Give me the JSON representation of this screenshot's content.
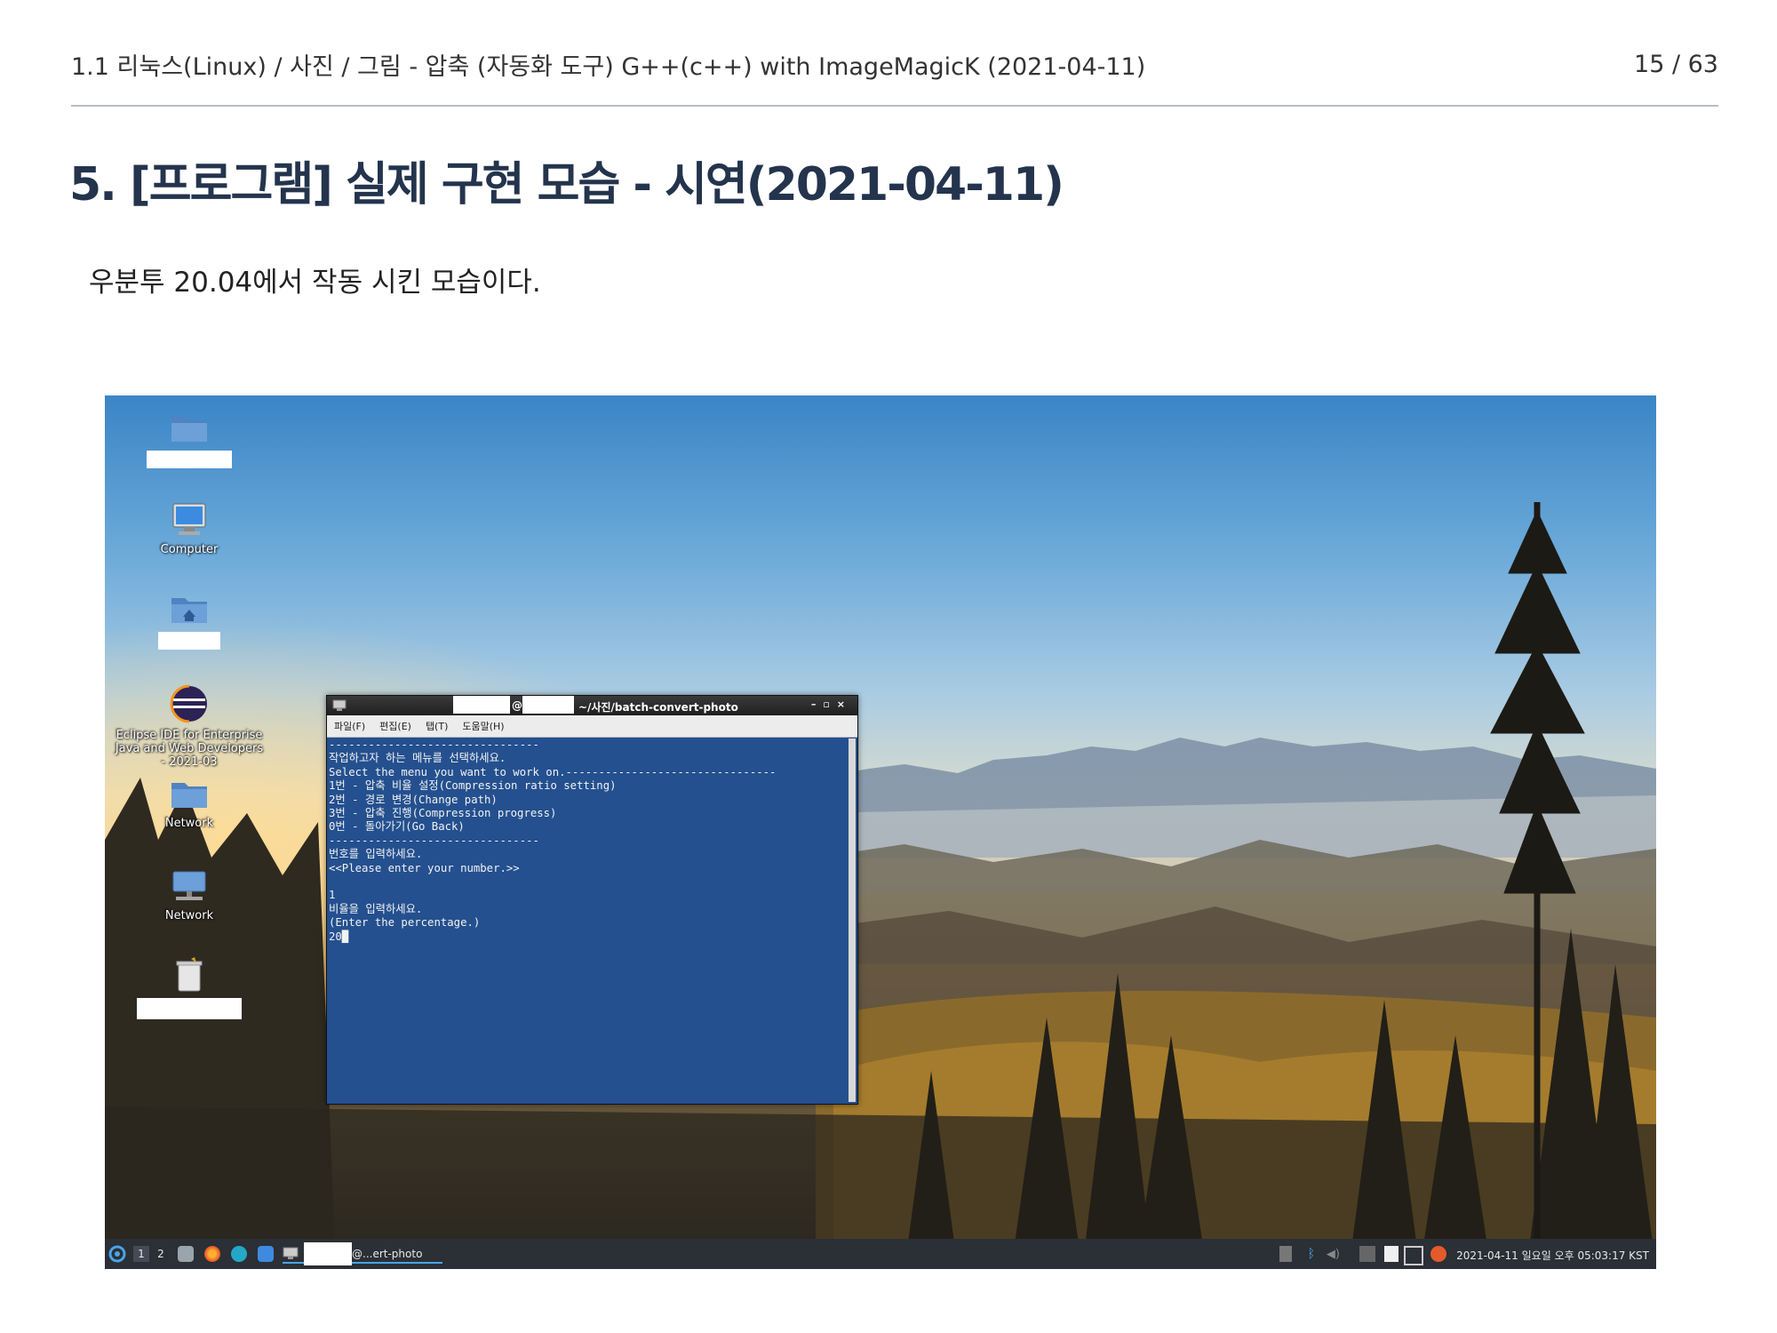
{
  "header": {
    "breadcrumb": "1.1 리눅스(Linux) / 사진 / 그림 - 압축 (자동화 도구) G++(c++) with ImageMagicK (2021-04-11)",
    "page_number": "15 / 63"
  },
  "title": "5. [프로그램] 실제 구현 모습 - 시연(2021-04-11)",
  "body_text": "우분투 20.04에서 작동 시킨 모습이다.",
  "desktop": {
    "icons": [
      {
        "name": "folder",
        "label": ""
      },
      {
        "name": "computer",
        "label": "Computer"
      },
      {
        "name": "home",
        "label": ""
      },
      {
        "name": "eclipse",
        "label": "Eclipse IDE for Enterprise Java and Web Developers - 2021-03"
      },
      {
        "name": "network",
        "label": "Network"
      },
      {
        "name": "network2",
        "label": "Network"
      },
      {
        "name": "trash",
        "label": ""
      }
    ]
  },
  "terminal": {
    "title": "~/사진/batch-convert-photo",
    "menu": [
      "파일(F)",
      "편집(E)",
      "탭(T)",
      "도움말(H)"
    ],
    "lines": [
      "--------------------------------",
      "작업하고자 하는 메뉴를 선택하세요.",
      "Select the menu you want to work on.--------------------------------",
      "1번 - 압축 비율 설정(Compression ratio setting)",
      "2번 - 경로 변경(Change path)",
      "3번 - 압축 진행(Compression progress)",
      "0번 - 돌아가기(Go Back)",
      "--------------------------------",
      "번호를 입력하세요.",
      "<<Please enter your number.>>",
      "",
      "1",
      "비율을 입력하세요.",
      "(Enter the percentage.)",
      "20█"
    ]
  },
  "taskbar": {
    "pager": [
      "1",
      "2"
    ],
    "window_label": "@...ert-photo",
    "clock": "2021-04-11 일요일 오후 05:03:17 KST"
  }
}
